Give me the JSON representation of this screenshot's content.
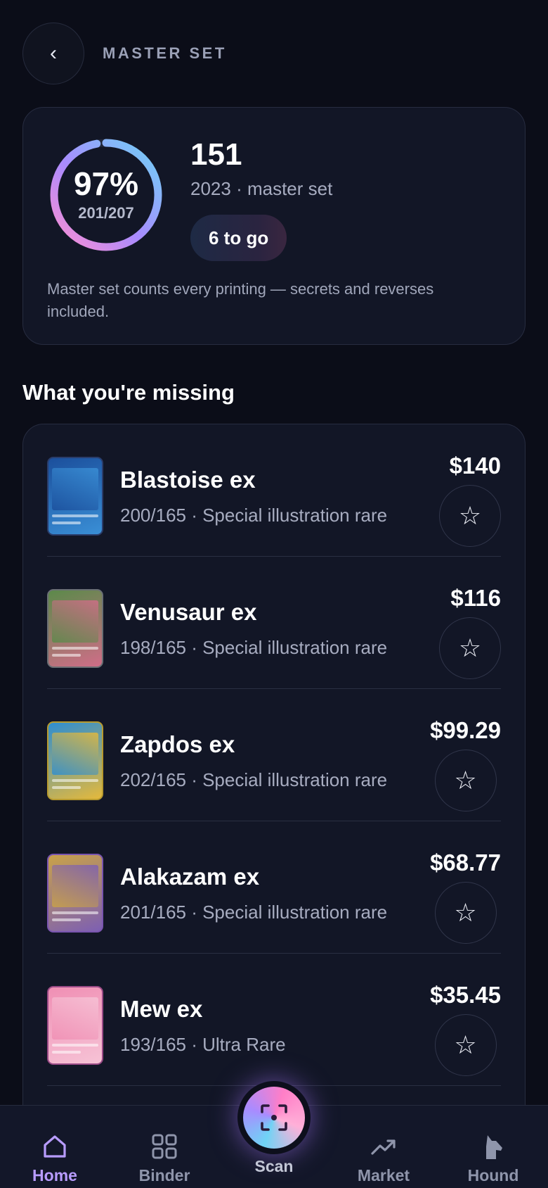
{
  "header": {
    "back_icon": "chevron-left-icon",
    "back_glyph": "‹",
    "title": "MASTER SET"
  },
  "set": {
    "progress_percent_label": "97%",
    "progress_fraction": "201/207",
    "progress_value": 0.971,
    "name": "151",
    "subtitle": "2023 · master set",
    "to_go_label": "6 to go",
    "note": "Master set counts every printing — secrets and reverses included."
  },
  "missing": {
    "title": "What you're missing",
    "items": [
      {
        "name": "Blastoise ex",
        "detail": "200/165 · Special illustration rare",
        "price": "$140",
        "art_colors": [
          "#1b4f9c",
          "#3a8fd6"
        ],
        "frame": "#2a3d6b"
      },
      {
        "name": "Venusaur ex",
        "detail": "198/165 · Special illustration rare",
        "price": "$116",
        "art_colors": [
          "#5b8a4a",
          "#d06d88"
        ],
        "frame": "#6a6f74"
      },
      {
        "name": "Zapdos ex",
        "detail": "202/165 · Special illustration rare",
        "price": "$99.29",
        "art_colors": [
          "#2f8ed0",
          "#e5b93b"
        ],
        "frame": "#b79a2e"
      },
      {
        "name": "Alakazam ex",
        "detail": "201/165 · Special illustration rare",
        "price": "$68.77",
        "art_colors": [
          "#c9a248",
          "#7d5fb3"
        ],
        "frame": "#7a55b0"
      },
      {
        "name": "Mew ex",
        "detail": "193/165 · Ultra Rare",
        "price": "$35.45",
        "art_colors": [
          "#f08fb4",
          "#f6c3d6"
        ],
        "frame": "#9a4a86"
      }
    ],
    "star_glyph": "☆",
    "star_icon": "star-outline-icon"
  },
  "nav": {
    "items": [
      {
        "label": "Home",
        "icon": "home-icon",
        "active": true
      },
      {
        "label": "Binder",
        "icon": "grid-icon",
        "active": false
      },
      {
        "label": "Scan",
        "icon": "scan-icon",
        "active": false
      },
      {
        "label": "Market",
        "icon": "trend-up-icon",
        "active": false
      },
      {
        "label": "Hound",
        "icon": "dog-icon",
        "active": false
      }
    ]
  },
  "colors": {
    "accent": "#b89cff",
    "background": "#0b0d18",
    "card": "#121626"
  }
}
